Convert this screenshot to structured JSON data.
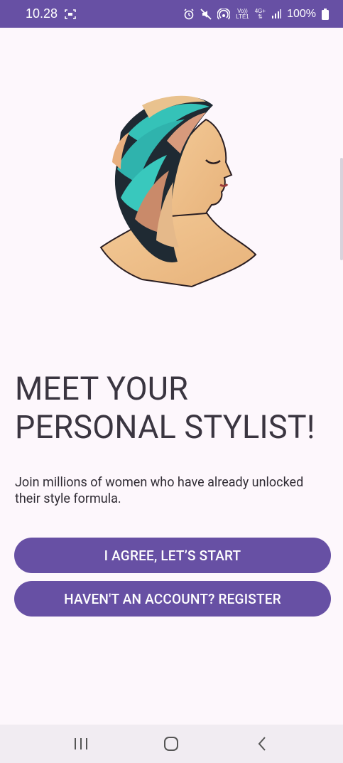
{
  "status_bar": {
    "time": "10.28",
    "volte_label_top": "Vo))",
    "volte_label_bottom": "LTE1",
    "network_label": "4G+",
    "battery": "100%"
  },
  "hero": {
    "image": "woman-profile-illustration"
  },
  "welcome": {
    "title_line1": "MEET YOUR",
    "title_line2": "PERSONAL STYLIST!",
    "subtitle": "Join millions of women who have already unlocked their style formula."
  },
  "actions": {
    "agree_label": "I AGREE, LET’S START",
    "register_label": "HAVEN'T AN ACCOUNT? REGISTER"
  },
  "colors": {
    "accent": "#6750A4",
    "background": "#FDF7FC"
  },
  "nav_bar": {
    "recents": "recents-icon",
    "home": "home-icon",
    "back": "back-icon"
  }
}
